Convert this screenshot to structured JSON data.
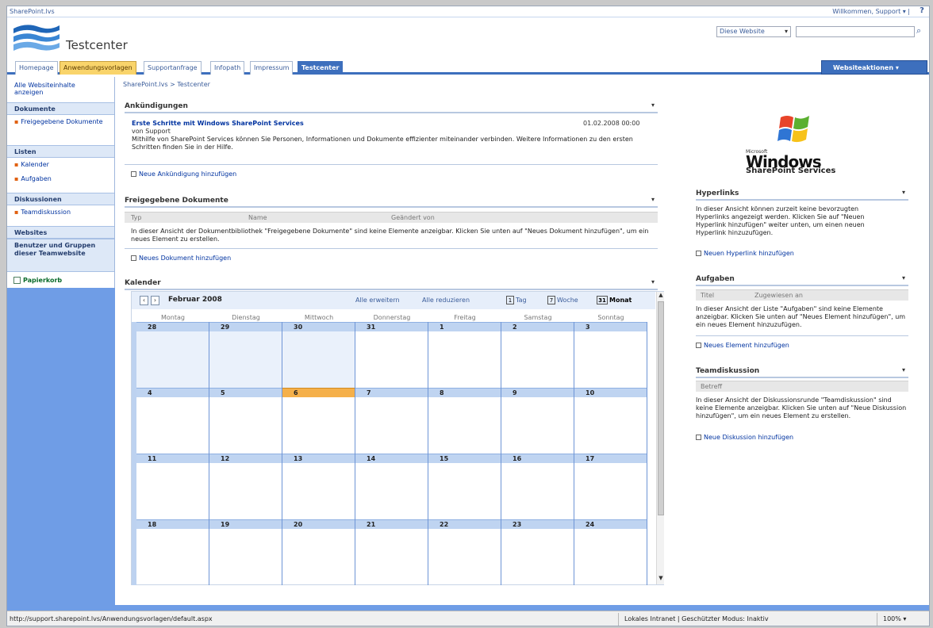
{
  "topbar": {
    "site": "SharePoint.lvs",
    "welcome": "Willkommen, Support ▾ |",
    "help": "?"
  },
  "header": {
    "title": "Testcenter",
    "scope": "Diese Website",
    "scope_arrow": "▾",
    "search_placeholder": "",
    "search_icon": "⌕"
  },
  "tabs": [
    {
      "label": "Homepage"
    },
    {
      "label": "Anwendungsvorlagen"
    },
    {
      "label": "Supportanfrage"
    },
    {
      "label": "Infopath"
    },
    {
      "label": "Impressum"
    },
    {
      "label": "Testcenter"
    }
  ],
  "site_actions": "Websiteaktionen ▾",
  "nav": {
    "all_content": "Alle Websiteinhalte anzeigen",
    "documents_head": "Dokumente",
    "documents_items": [
      "Freigegebene Dokumente"
    ],
    "lists_head": "Listen",
    "lists_items": [
      "Kalender",
      "Aufgaben"
    ],
    "discussions_head": "Diskussionen",
    "discussions_items": [
      "Teamdiskussion"
    ],
    "sites_head": "Websites",
    "people_head": "Benutzer und Gruppen dieser Teamwebsite",
    "recycle": "Papierkorb"
  },
  "breadcrumb": "SharePoint.lvs > Testcenter",
  "announcements": {
    "title": "Ankündigungen",
    "collapse": "▾",
    "item_title": "Erste Schritte mit Windows SharePoint Services",
    "item_date": "01.02.2008 00:00",
    "item_author": "von Support",
    "item_body": "Mithilfe von SharePoint Services können Sie Personen, Informationen und Dokumente effizienter miteinander verbinden. Weitere Informationen zu den ersten Schritten finden Sie in der Hilfe.",
    "add": "Neue Ankündigung hinzufügen"
  },
  "shared_docs": {
    "title": "Freigegebene Dokumente",
    "collapse": "▾",
    "col_type": "Typ",
    "col_name": "Name",
    "col_checked": "Geändert von",
    "empty": "In dieser Ansicht der Dokumentbibliothek \"Freigegebene Dokumente\" sind keine Elemente anzeigbar. Klicken Sie unten auf \"Neues Dokument hinzufügen\", um ein neues Element zu erstellen.",
    "add": "Neues Dokument hinzufügen"
  },
  "calendar": {
    "title": "Kalender",
    "collapse": "▾",
    "prev": "‹",
    "next": "›",
    "month": "Februar 2008",
    "expand_all": "Alle erweitern",
    "collapse_all": "Alle reduzieren",
    "view_day_icon": "1",
    "view_day": "Tag",
    "view_week_icon": "7",
    "view_week": "Woche",
    "view_month_icon": "31",
    "view_month": "Monat",
    "days": [
      "Montag",
      "Dienstag",
      "Mittwoch",
      "Donnerstag",
      "Freitag",
      "Samstag",
      "Sonntag"
    ],
    "weeks": [
      [
        "28",
        "29",
        "30",
        "31",
        "1",
        "2",
        "3"
      ],
      [
        "4",
        "5",
        "6",
        "7",
        "8",
        "9",
        "10"
      ],
      [
        "11",
        "12",
        "13",
        "14",
        "15",
        "16",
        "17"
      ],
      [
        "18",
        "19",
        "20",
        "21",
        "22",
        "23",
        "24"
      ]
    ],
    "today": "6",
    "scroll_up": "▲",
    "scroll_down": "▼"
  },
  "right": {
    "logo_microsoft": "Microsoft",
    "logo_windows": "Windows",
    "logo_sps": "SharePoint Services",
    "hyperlinks_title": "Hyperlinks",
    "hyperlinks_text": "In dieser Ansicht können zurzeit keine bevorzugten Hyperlinks angezeigt werden. Klicken Sie auf \"Neuen Hyperlink hinzufügen\" weiter unten, um einen neuen Hyperlink hinzuzufügen.",
    "hyperlinks_add": "Neuen Hyperlink hinzufügen",
    "tasks_title": "Aufgaben",
    "tasks_col_title": "Titel",
    "tasks_col_assigned": "Zugewiesen an",
    "tasks_text": "In dieser Ansicht der Liste \"Aufgaben\" sind keine Elemente anzeigbar. Klicken Sie unten auf \"Neues Element hinzufügen\", um ein neues Element hinzuzufügen.",
    "tasks_add": "Neues Element hinzufügen",
    "team_title": "Teamdiskussion",
    "team_col": "Betreff",
    "team_text": "In dieser Ansicht der Diskussionsrunde \"Teamdiskussion\" sind keine Elemente anzeigbar. Klicken Sie unten auf \"Neue Diskussion hinzufügen\", um ein neues Element zu erstellen.",
    "team_add": "Neue Diskussion hinzufügen",
    "collapse": "▾"
  },
  "status": {
    "url": "http://support.sharepoint.lvs/Anwendungsvorlagen/default.aspx",
    "zone": "Lokales Intranet | Geschützter Modus: Inaktiv",
    "zoom": "100% ▾"
  },
  "colors": {
    "accent": "#3d6fbd",
    "nav": "#6f9de6",
    "today": "#f5b04a"
  }
}
